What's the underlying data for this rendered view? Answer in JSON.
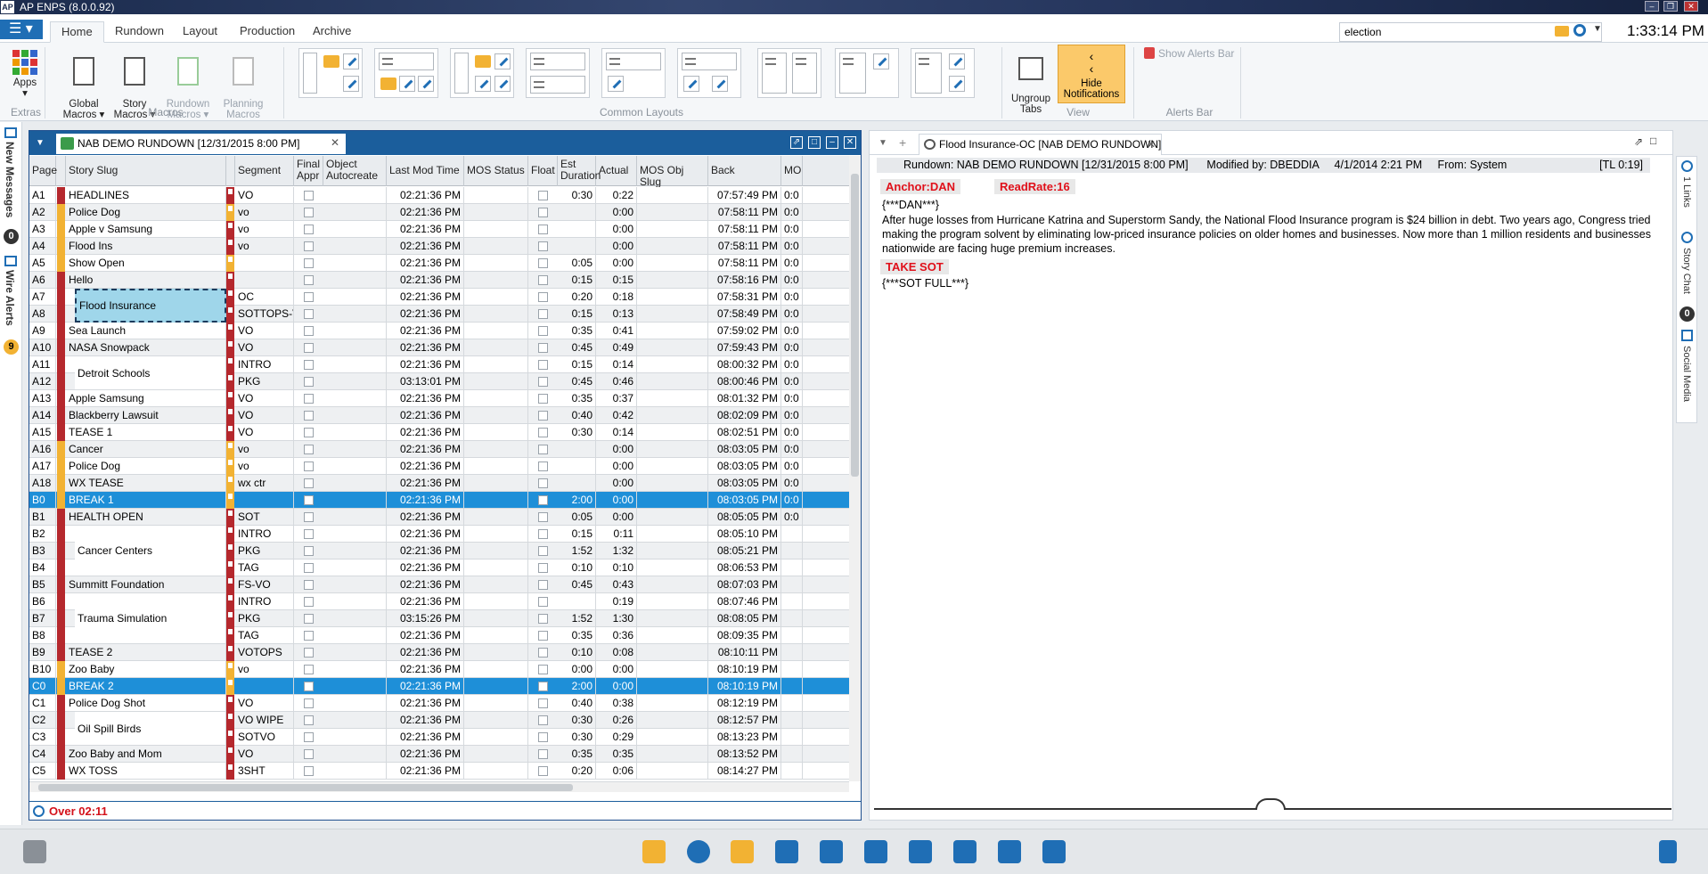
{
  "app": {
    "title": "AP ENPS (8.0.0.92)",
    "logo": "AP",
    "clock": "1:33:14 PM"
  },
  "ribbon": {
    "tabs": [
      "Home",
      "Rundown",
      "Layout",
      "Production",
      "Archive"
    ],
    "search_value": "election",
    "buttons": {
      "apps": "Apps",
      "global_macros": "Global\nMacros ▾",
      "story_macros": "Story\nMacros ▾",
      "rundown_macros": "Rundown\nMacros ▾",
      "planning_macros": "Planning\nMacros",
      "ungroup_tabs": "Ungroup\nTabs",
      "hide_notifications": "Hide\nNotifications",
      "show_alerts_bar": "Show Alerts Bar"
    },
    "groups": {
      "extras": "Extras",
      "macros": "Macros",
      "common_layouts": "Common Layouts",
      "view": "View",
      "alerts_bar": "Alerts Bar"
    }
  },
  "left_rail": {
    "new_messages": "New Messages",
    "new_messages_count": "0",
    "wire_alerts": "Wire Alerts",
    "wire_alerts_count": "9"
  },
  "rundown": {
    "tab_title": "NAB DEMO RUNDOWN [12/31/2015 8:00 PM]",
    "columns": [
      "Page",
      "Story Slug",
      "Segment",
      "Final Appr",
      "Object Autocreate",
      "Last Mod Time",
      "MOS Status",
      "Float",
      "Est Duration",
      "Actual",
      "MOS Obj Slug",
      "Back",
      "MO"
    ],
    "rows": [
      {
        "page": "A1",
        "slug": "HEADLINES",
        "seg": "VO",
        "time": "02:21:36 PM",
        "est": "0:30",
        "act": "0:22",
        "back": "07:57:49 PM",
        "mo": "0:0",
        "bar": "red",
        "sb": "red"
      },
      {
        "page": "A2",
        "slug": "Police Dog",
        "seg": "vo",
        "time": "02:21:36 PM",
        "est": "",
        "act": "0:00",
        "back": "07:58:11 PM",
        "mo": "0:0",
        "bar": "yel",
        "sb": "yel"
      },
      {
        "page": "A3",
        "slug": "Apple v Samsung",
        "seg": "vo",
        "time": "02:21:36 PM",
        "est": "",
        "act": "0:00",
        "back": "07:58:11 PM",
        "mo": "0:0",
        "bar": "yel",
        "sb": "red"
      },
      {
        "page": "A4",
        "slug": "Flood Ins",
        "seg": "vo",
        "time": "02:21:36 PM",
        "est": "",
        "act": "0:00",
        "back": "07:58:11 PM",
        "mo": "0:0",
        "bar": "yel",
        "sb": "red"
      },
      {
        "page": "A5",
        "slug": "Show Open",
        "seg": "",
        "time": "02:21:36 PM",
        "est": "0:05",
        "act": "0:00",
        "back": "07:58:11 PM",
        "mo": "0:0",
        "bar": "yel",
        "sb": "yel"
      },
      {
        "page": "A6",
        "slug": "Hello",
        "seg": "",
        "time": "02:21:36 PM",
        "est": "0:15",
        "act": "0:15",
        "back": "07:58:16 PM",
        "mo": "0:0",
        "bar": "red",
        "sb": "red"
      },
      {
        "page": "A7",
        "slug": "",
        "seg": "OC",
        "time": "02:21:36 PM",
        "est": "0:20",
        "act": "0:18",
        "back": "07:58:31 PM",
        "mo": "0:0",
        "bar": "red",
        "sb": "red"
      },
      {
        "page": "A8",
        "slug": "",
        "seg": "SOTTOPS-V(",
        "time": "02:21:36 PM",
        "est": "0:15",
        "act": "0:13",
        "back": "07:58:49 PM",
        "mo": "0:0",
        "bar": "red",
        "sb": "red"
      },
      {
        "page": "A9",
        "slug": "Sea Launch",
        "seg": "VO",
        "time": "02:21:36 PM",
        "est": "0:35",
        "act": "0:41",
        "back": "07:59:02 PM",
        "mo": "0:0",
        "bar": "red",
        "sb": "red"
      },
      {
        "page": "A10",
        "slug": "NASA Snowpack",
        "seg": "VO",
        "time": "02:21:36 PM",
        "est": "0:45",
        "act": "0:49",
        "back": "07:59:43 PM",
        "mo": "0:0",
        "bar": "red",
        "sb": "red"
      },
      {
        "page": "A11",
        "slug": "",
        "seg": "INTRO",
        "time": "02:21:36 PM",
        "est": "0:15",
        "act": "0:14",
        "back": "08:00:32 PM",
        "mo": "0:0",
        "bar": "red",
        "sb": "red"
      },
      {
        "page": "A12",
        "slug": "",
        "seg": "PKG",
        "time": "03:13:01 PM",
        "est": "0:45",
        "act": "0:46",
        "back": "08:00:46 PM",
        "mo": "0:0",
        "bar": "red",
        "sb": "red"
      },
      {
        "page": "A13",
        "slug": "Apple Samsung",
        "seg": "VO",
        "time": "02:21:36 PM",
        "est": "0:35",
        "act": "0:37",
        "back": "08:01:32 PM",
        "mo": "0:0",
        "bar": "red",
        "sb": "red"
      },
      {
        "page": "A14",
        "slug": "Blackberry Lawsuit",
        "seg": "VO",
        "time": "02:21:36 PM",
        "est": "0:40",
        "act": "0:42",
        "back": "08:02:09 PM",
        "mo": "0:0",
        "bar": "red",
        "sb": "red"
      },
      {
        "page": "A15",
        "slug": "TEASE 1",
        "seg": "VO",
        "time": "02:21:36 PM",
        "est": "0:30",
        "act": "0:14",
        "back": "08:02:51 PM",
        "mo": "0:0",
        "bar": "red",
        "sb": "red"
      },
      {
        "page": "A16",
        "slug": "Cancer",
        "seg": "vo",
        "time": "02:21:36 PM",
        "est": "",
        "act": "0:00",
        "back": "08:03:05 PM",
        "mo": "0:0",
        "bar": "yel",
        "sb": "yel"
      },
      {
        "page": "A17",
        "slug": "Police Dog",
        "seg": "vo",
        "time": "02:21:36 PM",
        "est": "",
        "act": "0:00",
        "back": "08:03:05 PM",
        "mo": "0:0",
        "bar": "yel",
        "sb": "yel"
      },
      {
        "page": "A18",
        "slug": "WX TEASE",
        "seg": "wx ctr",
        "time": "02:21:36 PM",
        "est": "",
        "act": "0:00",
        "back": "08:03:05 PM",
        "mo": "0:0",
        "bar": "yel",
        "sb": "yel"
      },
      {
        "page": "B0",
        "slug": "BREAK 1",
        "seg": "",
        "time": "02:21:36 PM",
        "est": "2:00",
        "act": "0:00",
        "back": "08:03:05 PM",
        "mo": "0:0",
        "bar": "yel",
        "sb": "yel",
        "brk": true
      },
      {
        "page": "B1",
        "slug": "HEALTH OPEN",
        "seg": "SOT",
        "time": "02:21:36 PM",
        "est": "0:05",
        "act": "0:00",
        "back": "08:05:05 PM",
        "mo": "0:0",
        "bar": "red",
        "sb": "red"
      },
      {
        "page": "B2",
        "slug": "",
        "seg": "INTRO",
        "time": "02:21:36 PM",
        "est": "0:15",
        "act": "0:11",
        "back": "08:05:10 PM",
        "mo": "",
        "bar": "red",
        "sb": "red"
      },
      {
        "page": "B3",
        "slug": "",
        "seg": "PKG",
        "time": "02:21:36 PM",
        "est": "1:52",
        "act": "1:32",
        "back": "08:05:21 PM",
        "mo": "",
        "bar": "red",
        "sb": "red"
      },
      {
        "page": "B4",
        "slug": "",
        "seg": "TAG",
        "time": "02:21:36 PM",
        "est": "0:10",
        "act": "0:10",
        "back": "08:06:53 PM",
        "mo": "",
        "bar": "red",
        "sb": "red"
      },
      {
        "page": "B5",
        "slug": "Summitt Foundation",
        "seg": "FS-VO",
        "time": "02:21:36 PM",
        "est": "0:45",
        "act": "0:43",
        "back": "08:07:03 PM",
        "mo": "",
        "bar": "red",
        "sb": "red"
      },
      {
        "page": "B6",
        "slug": "",
        "seg": "INTRO",
        "time": "02:21:36 PM",
        "est": "",
        "act": "0:19",
        "back": "08:07:46 PM",
        "mo": "",
        "bar": "red",
        "sb": "red"
      },
      {
        "page": "B7",
        "slug": "",
        "seg": "PKG",
        "time": "03:15:26 PM",
        "est": "1:52",
        "act": "1:30",
        "back": "08:08:05 PM",
        "mo": "",
        "bar": "red",
        "sb": "red"
      },
      {
        "page": "B8",
        "slug": "",
        "seg": "TAG",
        "time": "02:21:36 PM",
        "est": "0:35",
        "act": "0:36",
        "back": "08:09:35 PM",
        "mo": "",
        "bar": "red",
        "sb": "red"
      },
      {
        "page": "B9",
        "slug": "TEASE 2",
        "seg": "VOTOPS",
        "time": "02:21:36 PM",
        "est": "0:10",
        "act": "0:08",
        "back": "08:10:11 PM",
        "mo": "",
        "bar": "red",
        "sb": "red"
      },
      {
        "page": "B10",
        "slug": "Zoo Baby",
        "seg": "vo",
        "time": "02:21:36 PM",
        "est": "0:00",
        "act": "0:00",
        "back": "08:10:19 PM",
        "mo": "",
        "bar": "yel",
        "sb": "yel"
      },
      {
        "page": "C0",
        "slug": "BREAK 2",
        "seg": "",
        "time": "02:21:36 PM",
        "est": "2:00",
        "act": "0:00",
        "back": "08:10:19 PM",
        "mo": "",
        "bar": "yel",
        "sb": "yel",
        "brk": true
      },
      {
        "page": "C1",
        "slug": "Police Dog Shot",
        "seg": "VO",
        "time": "02:21:36 PM",
        "est": "0:40",
        "act": "0:38",
        "back": "08:12:19 PM",
        "mo": "",
        "bar": "red",
        "sb": "red"
      },
      {
        "page": "C2",
        "slug": "",
        "seg": "VO WIPE",
        "time": "02:21:36 PM",
        "est": "0:30",
        "act": "0:26",
        "back": "08:12:57 PM",
        "mo": "",
        "bar": "red",
        "sb": "red"
      },
      {
        "page": "C3",
        "slug": "",
        "seg": "SOTVO",
        "time": "02:21:36 PM",
        "est": "0:30",
        "act": "0:29",
        "back": "08:13:23 PM",
        "mo": "",
        "bar": "red",
        "sb": "red"
      },
      {
        "page": "C4",
        "slug": "Zoo Baby and Mom",
        "seg": "VO",
        "time": "02:21:36 PM",
        "est": "0:35",
        "act": "0:35",
        "back": "08:13:52 PM",
        "mo": "",
        "bar": "red",
        "sb": "red"
      },
      {
        "page": "C5",
        "slug": "WX TOSS",
        "seg": "3SHT",
        "time": "02:21:36 PM",
        "est": "0:20",
        "act": "0:06",
        "back": "08:14:27 PM",
        "mo": "",
        "bar": "red",
        "sb": "red"
      }
    ],
    "merged_slugs": [
      "Flood Insurance",
      "Detroit Schools",
      "Cancer Centers",
      "Trauma Simulation",
      "Oil Spill Birds"
    ],
    "over_label": "Over 02:11"
  },
  "story": {
    "tab_title": "Flood Insurance-OC [NAB DEMO RUNDOWN]",
    "info": "Rundown: NAB DEMO RUNDOWN [12/31/2015 8:00 PM]      Modified by: DBEDDIA     4/1/2014 2:21 PM     From: System",
    "tl": "[TL 0:19]",
    "anchor_tag": "Anchor:DAN",
    "readrate_tag": "ReadRate:16",
    "dan_line": "{***DAN***}",
    "body": "After huge losses from Hurricane Katrina and Superstorm Sandy, the National Flood Insurance program is $24 billion in debt. Two years ago, Congress tried making the program solvent by eliminating low-priced insurance policies on older homes and businesses.  Now more than 1 million residents and businesses nationwide are facing huge premium increases.",
    "take_sot": "TAKE SOT",
    "sot_full": "{***SOT FULL***}"
  },
  "right_rail": {
    "links": "1 Links",
    "story_chat": "Story Chat",
    "story_chat_count": "0",
    "social_media": "Social Media"
  },
  "colors": {
    "accent": "#1f6eb5",
    "break_row": "#1e8fd8",
    "red_bar": "#b5282d",
    "yellow_bar": "#f2b233",
    "selected_cell": "#9fd6ea"
  }
}
